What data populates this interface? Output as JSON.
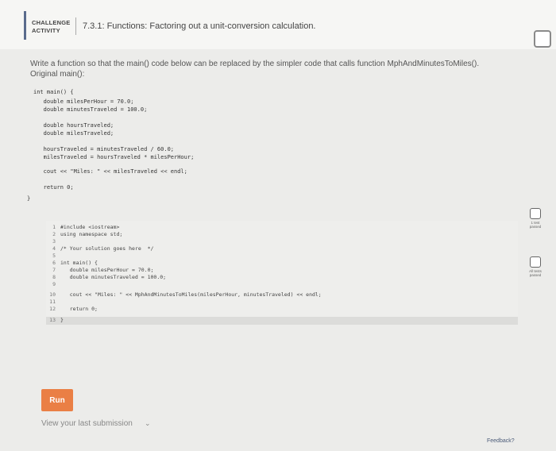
{
  "header": {
    "tag_line1": "CHALLENGE",
    "tag_line2": "ACTIVITY",
    "title": "7.3.1: Functions: Factoring out a unit-conversion calculation."
  },
  "description": {
    "line1": "Write a function so that the main() code below can be replaced by the simpler code that calls function MphAndMinutesToMiles().",
    "line2": "Original main():"
  },
  "original_code": [
    "int main() {",
    "   double milesPerHour = 70.0;",
    "   double minutesTraveled = 100.0;",
    "",
    "   double hoursTraveled;",
    "   double milesTraveled;",
    "",
    "   hoursTraveled = minutesTraveled / 60.0;",
    "   milesTraveled = hoursTraveled * milesPerHour;",
    "",
    "   cout << \"Miles: \" << milesTraveled << endl;",
    "",
    "   return 0;",
    "}"
  ],
  "editor": {
    "lines": [
      {
        "n": "1",
        "text": "#include <iostream>"
      },
      {
        "n": "2",
        "text": "using namespace std;"
      },
      {
        "n": "3",
        "text": ""
      },
      {
        "n": "4",
        "text": "/* Your solution goes here  */"
      },
      {
        "n": "5",
        "text": ""
      },
      {
        "n": "6",
        "text": "int main() {"
      },
      {
        "n": "7",
        "text": "   double milesPerHour = 70.0;"
      },
      {
        "n": "8",
        "text": "   double minutesTraveled = 100.0;"
      },
      {
        "n": "9",
        "text": ""
      },
      {
        "n": "10",
        "text": "   cout << \"Miles: \" << MphAndMinutesToMiles(milesPerHour, minutesTraveled) << endl;"
      },
      {
        "n": "11",
        "text": ""
      },
      {
        "n": "12",
        "text": "   return 0;"
      },
      {
        "n": "13",
        "text": "}"
      }
    ]
  },
  "tests": {
    "test1_line1": "1 test",
    "test1_line2": "passed",
    "test2_line1": "All tests",
    "test2_line2": "passed"
  },
  "actions": {
    "run_label": "Run",
    "last_submission": "View your last submission",
    "feedback": "Feedback?"
  }
}
